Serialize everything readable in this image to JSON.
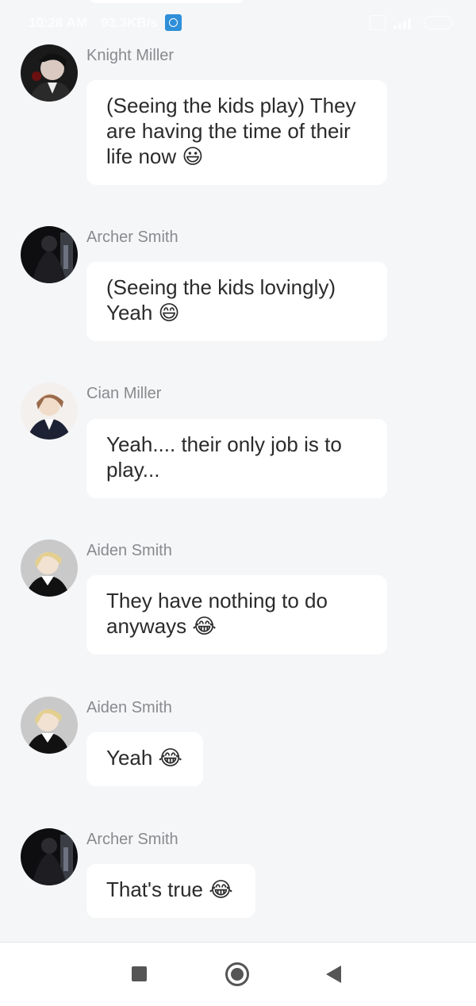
{
  "status_bar": {
    "time": "10:28 AM",
    "speed": "93.3KB/s"
  },
  "messages": [
    {
      "sender": "Knight Miller",
      "text": "(Seeing the kids play) They are having the time of their life now 😃"
    },
    {
      "sender": "Archer Smith",
      "text": "(Seeing the kids lovingly) Yeah 😄"
    },
    {
      "sender": "Cian Miller",
      "text": "Yeah.... their only job is to play..."
    },
    {
      "sender": "Aiden Smith",
      "text": "They have nothing to do anyways 😂"
    },
    {
      "sender": "Aiden Smith",
      "text": "Yeah 😂"
    },
    {
      "sender": "Archer Smith",
      "text": "That's true 😂"
    }
  ],
  "nav_bar": {
    "recents_icon": "square-icon",
    "home_icon": "circle-home-icon",
    "back_icon": "triangle-back-icon"
  }
}
